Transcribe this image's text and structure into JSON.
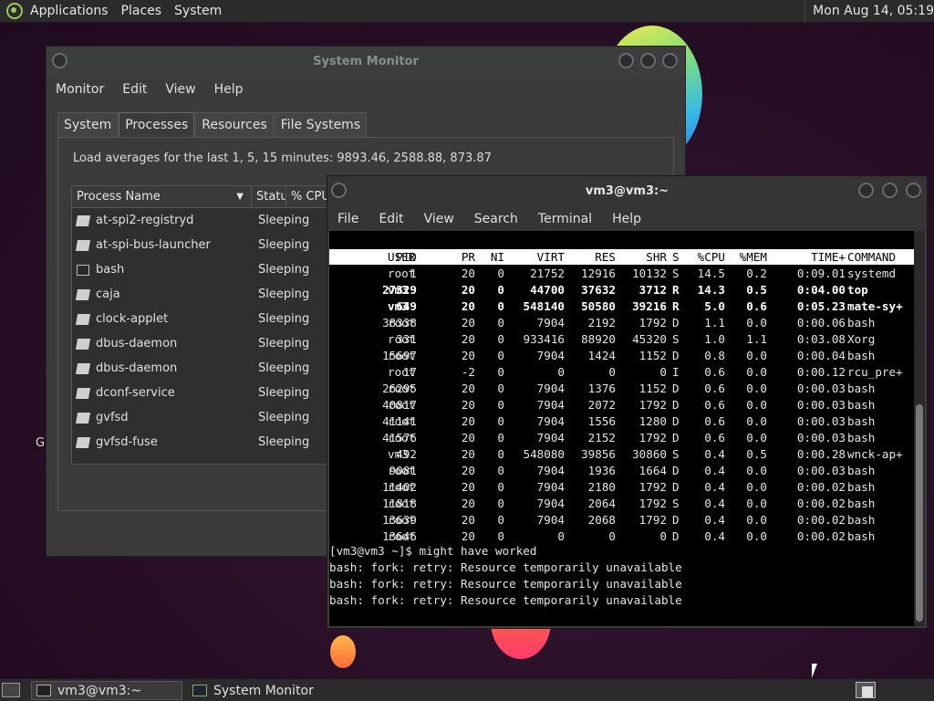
{
  "top_panel": {
    "menu": [
      "Applications",
      "Places",
      "System"
    ],
    "clock": "Mon Aug 14, 05:19"
  },
  "desktop": {
    "icon_letter": "G"
  },
  "sysmon": {
    "title": "System Monitor",
    "menu": [
      "Monitor",
      "Edit",
      "View",
      "Help"
    ],
    "tabs": [
      "System",
      "Processes",
      "Resources",
      "File Systems"
    ],
    "active_tab": "Processes",
    "load_averages": "Load averages for the last 1, 5, 15 minutes: 9893.46, 2588.88, 873.87",
    "columns": [
      "Process Name",
      "Status",
      "% CPU"
    ],
    "processes": [
      {
        "name": "at-spi2-registryd",
        "status": "Sleeping",
        "icon": "process-icon"
      },
      {
        "name": "at-spi-bus-launcher",
        "status": "Sleeping",
        "icon": "process-icon"
      },
      {
        "name": "bash",
        "status": "Sleeping",
        "icon": "terminal-icon"
      },
      {
        "name": "caja",
        "status": "Sleeping",
        "icon": "process-icon"
      },
      {
        "name": "clock-applet",
        "status": "Sleeping",
        "icon": "process-icon"
      },
      {
        "name": "dbus-daemon",
        "status": "Sleeping",
        "icon": "process-icon"
      },
      {
        "name": "dbus-daemon",
        "status": "Sleeping",
        "icon": "process-icon"
      },
      {
        "name": "dconf-service",
        "status": "Sleeping",
        "icon": "process-icon"
      },
      {
        "name": "gvfsd",
        "status": "Sleeping",
        "icon": "process-icon"
      },
      {
        "name": "gvfsd-fuse",
        "status": "Sleeping",
        "icon": "process-icon"
      }
    ]
  },
  "terminal": {
    "title": "vm3@vm3:~",
    "menu": [
      "File",
      "Edit",
      "View",
      "Search",
      "Terminal",
      "Help"
    ],
    "top_header": {
      "pid": "PID",
      "user": "USER",
      "pr": "PR",
      "ni": "NI",
      "virt": "VIRT",
      "res": "RES",
      "shr": "SHR",
      "s": "S",
      "cpu": "%CPU",
      "mem": "%MEM",
      "time": "TIME+",
      "command": "COMMAND"
    },
    "top_rows": [
      {
        "pid": "1",
        "user": "root",
        "pr": "20",
        "ni": "0",
        "virt": "21752",
        "res": "12916",
        "shr": "10132",
        "s": "S",
        "cpu": "14.5",
        "mem": "0.2",
        "time": "0:09.01",
        "command": "systemd",
        "bold": false
      },
      {
        "pid": "27329",
        "user": "vm3",
        "pr": "20",
        "ni": "0",
        "virt": "44700",
        "res": "37632",
        "shr": "3712",
        "s": "R",
        "cpu": "14.3",
        "mem": "0.5",
        "time": "0:04.00",
        "command": "top",
        "bold": true
      },
      {
        "pid": "649",
        "user": "vm3",
        "pr": "20",
        "ni": "0",
        "virt": "548140",
        "res": "50580",
        "shr": "39216",
        "s": "R",
        "cpu": "5.0",
        "mem": "0.6",
        "time": "0:05.23",
        "command": "mate-sy+",
        "bold": true
      },
      {
        "pid": "38338",
        "user": "root",
        "pr": "20",
        "ni": "0",
        "virt": "7904",
        "res": "2192",
        "shr": "1792",
        "s": "D",
        "cpu": "1.1",
        "mem": "0.0",
        "time": "0:00.06",
        "command": "bash",
        "bold": false
      },
      {
        "pid": "331",
        "user": "root",
        "pr": "20",
        "ni": "0",
        "virt": "933416",
        "res": "88920",
        "shr": "45320",
        "s": "S",
        "cpu": "1.0",
        "mem": "1.1",
        "time": "0:03.08",
        "command": "Xorg",
        "bold": false
      },
      {
        "pid": "15697",
        "user": "root",
        "pr": "20",
        "ni": "0",
        "virt": "7904",
        "res": "1424",
        "shr": "1152",
        "s": "D",
        "cpu": "0.8",
        "mem": "0.0",
        "time": "0:00.04",
        "command": "bash",
        "bold": false
      },
      {
        "pid": "17",
        "user": "root",
        "pr": "-2",
        "ni": "0",
        "virt": "0",
        "res": "0",
        "shr": "0",
        "s": "I",
        "cpu": "0.6",
        "mem": "0.0",
        "time": "0:00.12",
        "command": "rcu_pre+",
        "bold": false
      },
      {
        "pid": "26295",
        "user": "root",
        "pr": "20",
        "ni": "0",
        "virt": "7904",
        "res": "1376",
        "shr": "1152",
        "s": "D",
        "cpu": "0.6",
        "mem": "0.0",
        "time": "0:00.03",
        "command": "bash",
        "bold": false
      },
      {
        "pid": "40817",
        "user": "root",
        "pr": "20",
        "ni": "0",
        "virt": "7904",
        "res": "2072",
        "shr": "1792",
        "s": "D",
        "cpu": "0.6",
        "mem": "0.0",
        "time": "0:00.03",
        "command": "bash",
        "bold": false
      },
      {
        "pid": "41141",
        "user": "root",
        "pr": "20",
        "ni": "0",
        "virt": "7904",
        "res": "1556",
        "shr": "1280",
        "s": "D",
        "cpu": "0.6",
        "mem": "0.0",
        "time": "0:00.03",
        "command": "bash",
        "bold": false
      },
      {
        "pid": "41576",
        "user": "root",
        "pr": "20",
        "ni": "0",
        "virt": "7904",
        "res": "2152",
        "shr": "1792",
        "s": "D",
        "cpu": "0.6",
        "mem": "0.0",
        "time": "0:00.03",
        "command": "bash",
        "bold": false
      },
      {
        "pid": "492",
        "user": "vm3",
        "pr": "20",
        "ni": "0",
        "virt": "548080",
        "res": "39856",
        "shr": "30860",
        "s": "S",
        "cpu": "0.4",
        "mem": "0.5",
        "time": "0:00.28",
        "command": "wnck-ap+",
        "bold": false
      },
      {
        "pid": "9081",
        "user": "root",
        "pr": "20",
        "ni": "0",
        "virt": "7904",
        "res": "1936",
        "shr": "1664",
        "s": "D",
        "cpu": "0.4",
        "mem": "0.0",
        "time": "0:00.03",
        "command": "bash",
        "bold": false
      },
      {
        "pid": "11402",
        "user": "root",
        "pr": "20",
        "ni": "0",
        "virt": "7904",
        "res": "2180",
        "shr": "1792",
        "s": "D",
        "cpu": "0.4",
        "mem": "0.0",
        "time": "0:00.02",
        "command": "bash",
        "bold": false
      },
      {
        "pid": "11818",
        "user": "root",
        "pr": "20",
        "ni": "0",
        "virt": "7904",
        "res": "2064",
        "shr": "1792",
        "s": "S",
        "cpu": "0.4",
        "mem": "0.0",
        "time": "0:00.02",
        "command": "bash",
        "bold": false
      },
      {
        "pid": "13639",
        "user": "root",
        "pr": "20",
        "ni": "0",
        "virt": "7904",
        "res": "2068",
        "shr": "1792",
        "s": "D",
        "cpu": "0.4",
        "mem": "0.0",
        "time": "0:00.02",
        "command": "bash",
        "bold": false
      },
      {
        "pid": "13646",
        "user": "root",
        "pr": "20",
        "ni": "0",
        "virt": "0",
        "res": "0",
        "shr": "0",
        "s": "D",
        "cpu": "0.4",
        "mem": "0.0",
        "time": "0:00.02",
        "command": "bash",
        "bold": false
      }
    ],
    "shell_lines": [
      "[vm3@vm3 ~]$ might have worked",
      "bash: fork: retry: Resource temporarily unavailable",
      "bash: fork: retry: Resource temporarily unavailable",
      "bash: fork: retry: Resource temporarily unavailable"
    ]
  },
  "taskbar": {
    "items": [
      {
        "label": "vm3@vm3:~",
        "icon": "terminal-icon"
      },
      {
        "label": "System Monitor",
        "icon": "system-monitor-icon"
      }
    ]
  },
  "colors": {
    "desktop_bg": "#2a1028",
    "panel_bg": "#2b2b2b",
    "terminal_bg": "#000000",
    "window_bg": "#3b3b3b"
  }
}
